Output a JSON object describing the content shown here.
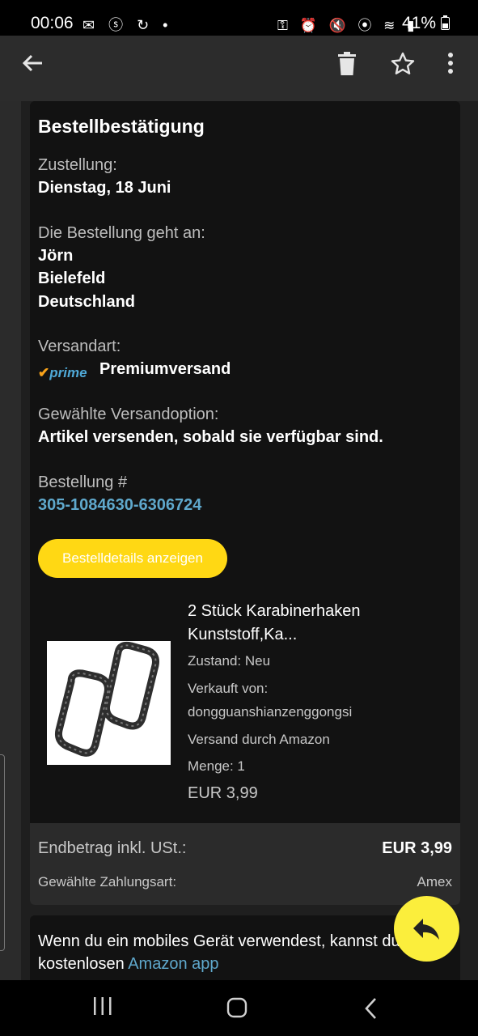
{
  "status_bar": {
    "time": "00:06",
    "left_icons": "✉ ⓢ ↻ •",
    "right_icons": "⚿ ⏰ 🔇 ⦿ ≋ ▮",
    "battery": "41%"
  },
  "toolbar": {
    "icons": [
      "back-arrow-icon",
      "trash-icon",
      "star-icon",
      "more-vertical-icon"
    ]
  },
  "order": {
    "title": "Bestellbestätigung",
    "delivery_label": "Zustellung:",
    "delivery_value": "Dienstag, 18 Juni",
    "recipient_label": "Die Bestellung geht an:",
    "recipient_name": "Jörn",
    "recipient_city": "Bielefeld",
    "recipient_country": "Deutschland",
    "shipping_label": "Versandart:",
    "prime_logo": "prime",
    "shipping_value": "Premiumversand",
    "option_label": "Gewählte Versandoption:",
    "option_value": "Artikel versenden, sobald sie verfügbar sind.",
    "number_label": "Bestellung #",
    "number_value": "305-1084630-6306724",
    "details_button": "Bestelldetails anzeigen"
  },
  "product": {
    "title": "2 Stück Karabinerhaken Kunststoff,Ka...",
    "condition": "Zustand: Neu",
    "seller_label": "Verkauft von:",
    "seller_name": "dongguanshianzenggongsi",
    "fulfillment": "Versand durch Amazon",
    "quantity": "Menge: 1",
    "price": "EUR 3,99"
  },
  "totals": {
    "total_label": "Endbetrag inkl. USt.:",
    "total_value": "EUR 3,99",
    "payment_label": "Gewählte Zahlungsart:",
    "payment_value": "Amex"
  },
  "app_promo": {
    "text": "Wenn du ein mobiles Gerät verwendest, kannst du der kostenlosen",
    "link": "Amazon app"
  },
  "colors": {
    "accent_yellow": "#ffd814",
    "fab_yellow": "#fbee3c",
    "link_blue": "#5fa8cc"
  }
}
